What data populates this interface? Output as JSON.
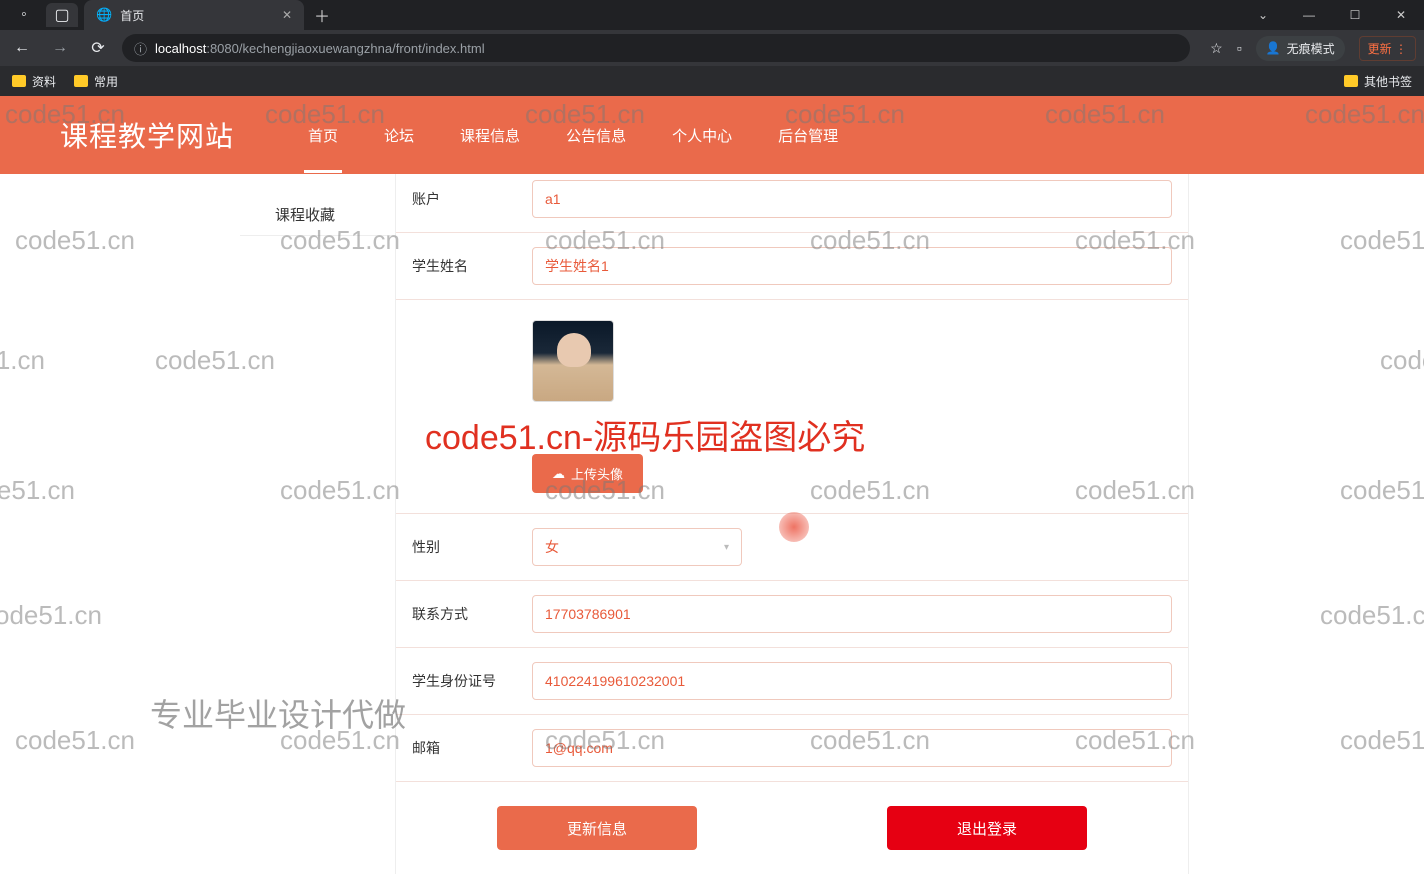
{
  "browser": {
    "tab_title": "首页",
    "url_host": "localhost",
    "url_port": ":8080",
    "url_path": "/kechengjiaoxuewangzhna/front/index.html",
    "incognito_label": "无痕模式",
    "update_label": "更新",
    "bookmarks": {
      "b1": "资料",
      "b2": "常用",
      "b3": "其他书签"
    }
  },
  "nav": {
    "site_title": "课程教学网站",
    "items": {
      "home": "首页",
      "forum": "论坛",
      "course": "课程信息",
      "notice": "公告信息",
      "personal": "个人中心",
      "admin": "后台管理"
    }
  },
  "sidebar": {
    "fav": "课程收藏"
  },
  "form": {
    "account_label": "账户",
    "account_value": "a1",
    "name_label": "学生姓名",
    "name_value": "学生姓名1",
    "upload_label": "上传头像",
    "gender_label": "性别",
    "gender_value": "女",
    "contact_label": "联系方式",
    "contact_value": "17703786901",
    "idcard_label": "学生身份证号",
    "idcard_value": "410224199610232001",
    "email_label": "邮箱",
    "email_value": "1@qq.com",
    "btn_update": "更新信息",
    "btn_logout": "退出登录"
  },
  "watermark": {
    "small": "code51.cn",
    "banner": "code51.cn-源码乐园盗图必究",
    "bottom": "专业毕业设计代做"
  }
}
